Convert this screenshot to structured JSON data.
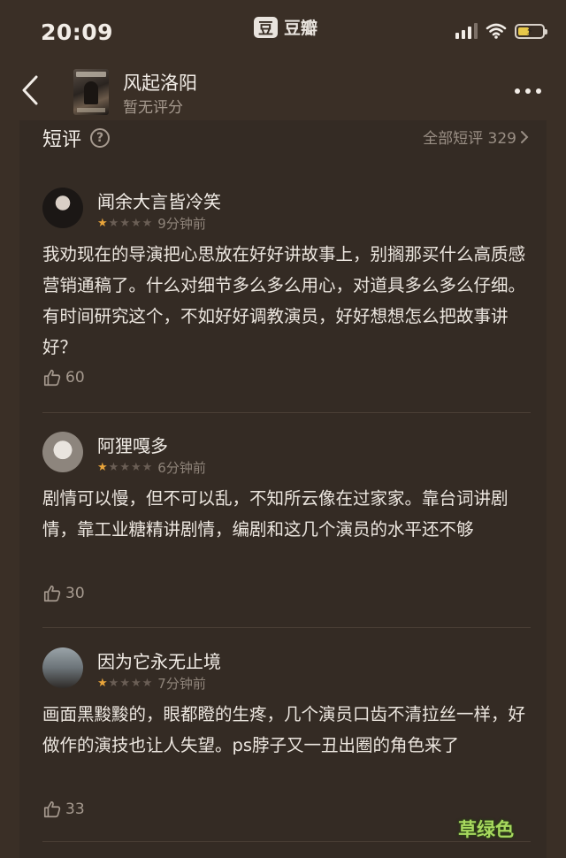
{
  "status_bar": {
    "time": "20:09",
    "app_name": "豆瓣",
    "app_logo": "豆"
  },
  "nav": {
    "title": "风起洛阳",
    "rating": "暂无评分"
  },
  "section": {
    "title": "短评",
    "help": "?",
    "all_label": "全部短评 329"
  },
  "reviews": [
    {
      "name": "闻余大言皆冷笑",
      "stars": 1,
      "time": "9分钟前",
      "text": "我劝现在的导演把心思放在好好讲故事上，别搁那买什么高质感营销通稿了。什么对细节多么多么用心，对道具多么多么仔细。有时间研究这个，不如好好调教演员，好好想想怎么把故事讲好？",
      "likes": "60"
    },
    {
      "name": "阿狸嘎多",
      "stars": 1,
      "time": "6分钟前",
      "text": "剧情可以慢，但不可以乱，不知所云像在过家家。靠台词讲剧情，靠工业糖精讲剧情，编剧和这几个演员的水平还不够",
      "likes": "30"
    },
    {
      "name": "因为它永无止境",
      "stars": 1,
      "time": "7分钟前",
      "text": "画面黑黢黢的，眼都瞪的生疼，几个演员口齿不清拉丝一样，好做作的演技也让人失望。ps脖子又一丑出圈的角色来了",
      "likes": "33"
    }
  ],
  "watermark": "草绿色",
  "icons": [
    "back-chevron-icon",
    "more-icon",
    "help-icon",
    "chevron-right-icon",
    "thumbs-up-icon",
    "signal-icon",
    "wifi-icon",
    "battery-icon",
    "star-icon"
  ],
  "colors": {
    "background": "#3a2f26",
    "panel": "#342b24",
    "star": "#e9a53b"
  }
}
